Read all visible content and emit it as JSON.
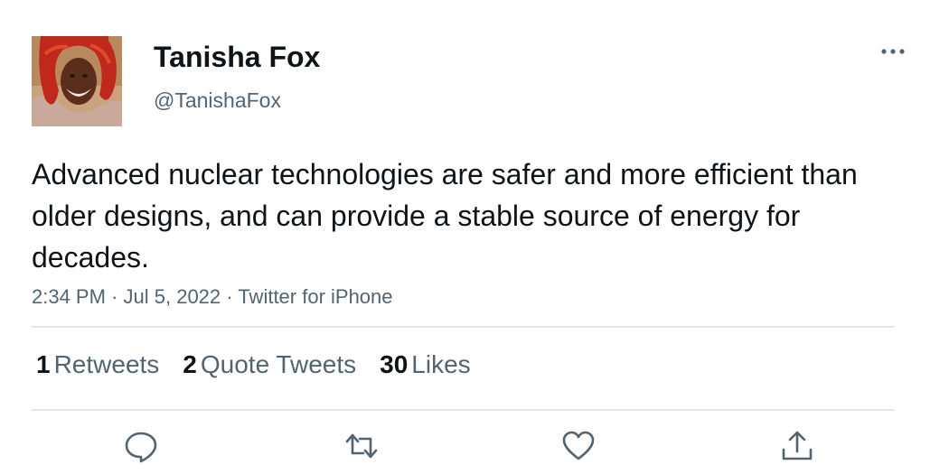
{
  "author": {
    "display_name": "Tanisha Fox",
    "handle": "@TanishaFox",
    "avatar": "profile-photo"
  },
  "menu": {
    "icon": "more-horizontal-icon"
  },
  "tweet": {
    "text": "Advanced nuclear technologies are safer and more efficient than older designs, and can provide a stable source of energy for decades.",
    "time": "2:34 PM",
    "date": "Jul 5, 2022",
    "source": "Twitter for iPhone",
    "separator": "·"
  },
  "stats": [
    {
      "count": "1",
      "label": "Retweets"
    },
    {
      "count": "2",
      "label": "Quote Tweets"
    },
    {
      "count": "30",
      "label": "Likes"
    }
  ],
  "actions": [
    {
      "name": "reply",
      "icon": "reply-icon"
    },
    {
      "name": "retweet",
      "icon": "retweet-icon"
    },
    {
      "name": "like",
      "icon": "heart-icon"
    },
    {
      "name": "share",
      "icon": "share-icon"
    }
  ],
  "colors": {
    "primary_text": "#0f1419",
    "secondary_text": "#536471",
    "divider": "#e4e7ea",
    "icon": "#536471"
  }
}
